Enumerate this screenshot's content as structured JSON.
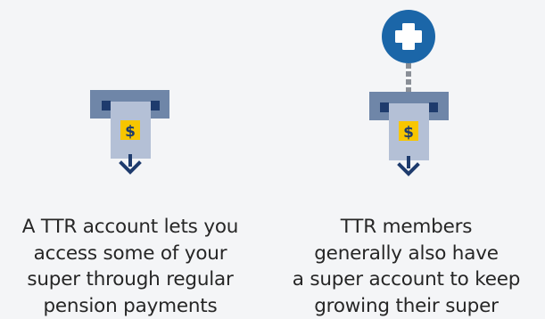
{
  "colors": {
    "background": "#f4f5f7",
    "slot": "#6f86a8",
    "slot_hole": "#1e3b6d",
    "bill": "#b4c0d6",
    "dollar_badge": "#f7c600",
    "arrow": "#1e3b6d",
    "plus_circle": "#1b66a8",
    "connector": "#8a8f97",
    "text": "#262626"
  },
  "icons": {
    "left": "pension-payment-icon",
    "right": "pension-payment-plus-icon",
    "dollar": "dollar-sign-icon",
    "arrow": "arrow-down-icon",
    "plus": "plus-icon"
  },
  "left_panel": {
    "dollar_symbol": "$",
    "caption_lines": [
      "A TTR account lets you",
      "access some of your",
      "super through regular",
      "pension payments"
    ]
  },
  "right_panel": {
    "dollar_symbol": "$",
    "caption_lines": [
      "TTR members",
      "generally also have",
      "a super account to keep",
      "growing their super"
    ]
  }
}
